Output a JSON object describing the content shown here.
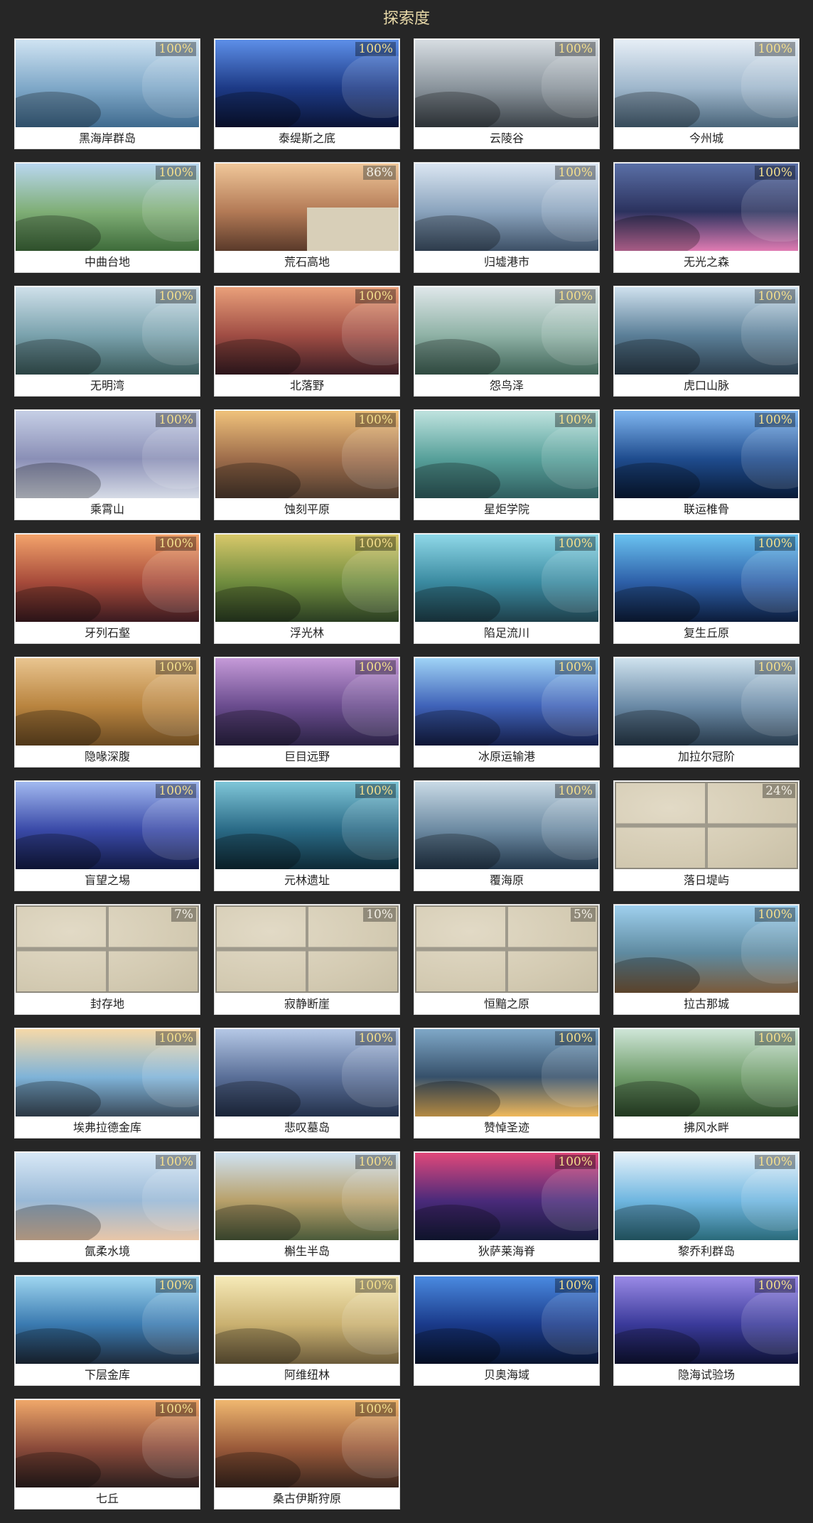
{
  "title": "探索度",
  "colors": {
    "background": "#262626",
    "title": "#e8d9a8",
    "percent": "#f3de8c",
    "card": "#ffffff"
  },
  "regions": [
    {
      "name": "黑海岸群岛",
      "progress": "100%",
      "thumb": "photo",
      "palette": [
        "#cfe3f2",
        "#7fa8c8",
        "#3f6a8e"
      ]
    },
    {
      "name": "泰缇斯之底",
      "progress": "100%",
      "thumb": "photo",
      "palette": [
        "#5d8fe8",
        "#1d3a86",
        "#0a1436"
      ]
    },
    {
      "name": "云陵谷",
      "progress": "100%",
      "thumb": "photo",
      "palette": [
        "#d7dde2",
        "#8a949c",
        "#3b4248"
      ]
    },
    {
      "name": "今州城",
      "progress": "100%",
      "thumb": "photo",
      "palette": [
        "#e6eef6",
        "#9fb7cc",
        "#496479"
      ]
    },
    {
      "name": "中曲台地",
      "progress": "100%",
      "thumb": "photo",
      "palette": [
        "#b9d7f0",
        "#7fae76",
        "#3e6b3a"
      ]
    },
    {
      "name": "荒石高地",
      "progress": "86%",
      "thumb": "mixed",
      "palette": [
        "#f0c79a",
        "#b37a56",
        "#5a3a2a"
      ]
    },
    {
      "name": "归墟港市",
      "progress": "100%",
      "thumb": "photo",
      "palette": [
        "#dbe6f2",
        "#8aa3bd",
        "#3d5066"
      ]
    },
    {
      "name": "无光之森",
      "progress": "100%",
      "thumb": "photo",
      "palette": [
        "#5a6fa6",
        "#2b325e",
        "#e07bb2"
      ]
    },
    {
      "name": "无明湾",
      "progress": "100%",
      "thumb": "photo",
      "palette": [
        "#cfe0ea",
        "#7aa2ad",
        "#3a5a5a"
      ]
    },
    {
      "name": "北落野",
      "progress": "100%",
      "thumb": "photo",
      "palette": [
        "#e9a07a",
        "#a04d44",
        "#3a1d24"
      ]
    },
    {
      "name": "怨鸟泽",
      "progress": "100%",
      "thumb": "photo",
      "palette": [
        "#dfe7ea",
        "#8fb2a6",
        "#3f6356"
      ]
    },
    {
      "name": "虎口山脉",
      "progress": "100%",
      "thumb": "photo",
      "palette": [
        "#cfe1ee",
        "#5b7f98",
        "#2a3b49"
      ]
    },
    {
      "name": "乘霄山",
      "progress": "100%",
      "thumb": "photo",
      "palette": [
        "#c6cfe6",
        "#8a8fb6",
        "#d6dbe6"
      ]
    },
    {
      "name": "蚀刻平原",
      "progress": "100%",
      "thumb": "photo",
      "palette": [
        "#f0c27b",
        "#9e6d4b",
        "#4c3a2e"
      ]
    },
    {
      "name": "星炬学院",
      "progress": "100%",
      "thumb": "photo",
      "palette": [
        "#bfe3df",
        "#57a09a",
        "#2f5d5e"
      ]
    },
    {
      "name": "联运椎骨",
      "progress": "100%",
      "thumb": "photo",
      "palette": [
        "#7fb6f0",
        "#1f4c8e",
        "#081a36"
      ]
    },
    {
      "name": "牙列石壑",
      "progress": "100%",
      "thumb": "photo",
      "palette": [
        "#f3a36b",
        "#a64a3a",
        "#3a1a20"
      ]
    },
    {
      "name": "浮光林",
      "progress": "100%",
      "thumb": "photo",
      "palette": [
        "#d8c86a",
        "#6f8c3e",
        "#2a3d22"
      ]
    },
    {
      "name": "陷足流川",
      "progress": "100%",
      "thumb": "photo",
      "palette": [
        "#8fd8e8",
        "#3a8aa0",
        "#1e3f4a"
      ]
    },
    {
      "name": "复生丘原",
      "progress": "100%",
      "thumb": "photo",
      "palette": [
        "#6ac2f0",
        "#2d5fa8",
        "#0c1c3a"
      ]
    },
    {
      "name": "隐喙深腹",
      "progress": "100%",
      "thumb": "photo",
      "palette": [
        "#e9c590",
        "#b9843f",
        "#6a4a22"
      ]
    },
    {
      "name": "巨目远野",
      "progress": "100%",
      "thumb": "photo",
      "palette": [
        "#c59ad8",
        "#6a4c8e",
        "#2a2244"
      ]
    },
    {
      "name": "冰原运输港",
      "progress": "100%",
      "thumb": "photo",
      "palette": [
        "#9fd3f6",
        "#3f62b8",
        "#141e48"
      ]
    },
    {
      "name": "加拉尔冠阶",
      "progress": "100%",
      "thumb": "photo",
      "palette": [
        "#cfe2ee",
        "#6a8aa6",
        "#27394a"
      ]
    },
    {
      "name": "盲望之埸",
      "progress": "100%",
      "thumb": "photo",
      "palette": [
        "#a2b9f0",
        "#3a4aa8",
        "#121a44"
      ]
    },
    {
      "name": "元林遗址",
      "progress": "100%",
      "thumb": "photo",
      "palette": [
        "#7fc6d8",
        "#2a6a86",
        "#0e2a36"
      ]
    },
    {
      "name": "覆海原",
      "progress": "100%",
      "thumb": "photo",
      "palette": [
        "#c9dae6",
        "#6c8aa2",
        "#22364a"
      ]
    },
    {
      "name": "落日堤屿",
      "progress": "24%",
      "thumb": "map",
      "palette": [
        "#e2dac6",
        "#d4cbb3",
        "#c8bfa6"
      ]
    },
    {
      "name": "封存地",
      "progress": "7%",
      "thumb": "map",
      "palette": [
        "#e2dac6",
        "#d4cbb3",
        "#c8bfa6"
      ]
    },
    {
      "name": "寂静断崖",
      "progress": "10%",
      "thumb": "map",
      "palette": [
        "#e2dac6",
        "#d4cbb3",
        "#c8bfa6"
      ]
    },
    {
      "name": "恒黯之原",
      "progress": "5%",
      "thumb": "map",
      "palette": [
        "#e2dac6",
        "#d4cbb3",
        "#c8bfa6"
      ]
    },
    {
      "name": "拉古那城",
      "progress": "100%",
      "thumb": "photo",
      "palette": [
        "#9fd0ee",
        "#5e8aa0",
        "#7a5a3a"
      ]
    },
    {
      "name": "埃弗拉德金库",
      "progress": "100%",
      "thumb": "photo",
      "palette": [
        "#f6d9a8",
        "#7fb3d8",
        "#3a4a5a"
      ]
    },
    {
      "name": "悲叹墓岛",
      "progress": "100%",
      "thumb": "photo",
      "palette": [
        "#b5c8e6",
        "#5a6f98",
        "#23304a"
      ]
    },
    {
      "name": "赞悼圣迹",
      "progress": "100%",
      "thumb": "photo",
      "palette": [
        "#7fa8c8",
        "#36506a",
        "#f0b85a"
      ]
    },
    {
      "name": "拂风水畔",
      "progress": "100%",
      "thumb": "photo",
      "palette": [
        "#cfe6d8",
        "#6f9c6a",
        "#2d4a2a"
      ]
    },
    {
      "name": "氤柔水境",
      "progress": "100%",
      "thumb": "photo",
      "palette": [
        "#d8e8f6",
        "#98b8d6",
        "#e8c6a8"
      ]
    },
    {
      "name": "槲生半岛",
      "progress": "100%",
      "thumb": "photo",
      "palette": [
        "#cfe2f2",
        "#b8a06a",
        "#4a5a3a"
      ]
    },
    {
      "name": "狄萨莱海脊",
      "progress": "100%",
      "thumb": "photo",
      "palette": [
        "#e0487a",
        "#4a2a7a",
        "#141a3a"
      ]
    },
    {
      "name": "黎乔利群岛",
      "progress": "100%",
      "thumb": "photo",
      "palette": [
        "#e6f2fa",
        "#6fb6e0",
        "#2a6a7a"
      ]
    },
    {
      "name": "下层金库",
      "progress": "100%",
      "thumb": "photo",
      "palette": [
        "#9fd6f0",
        "#3a7ab0",
        "#1e2a3a"
      ]
    },
    {
      "name": "阿维纽林",
      "progress": "100%",
      "thumb": "photo",
      "palette": [
        "#f6eab8",
        "#c9b070",
        "#6a5a3a"
      ]
    },
    {
      "name": "贝奥海域",
      "progress": "100%",
      "thumb": "photo",
      "palette": [
        "#4a8ae0",
        "#1a3a8a",
        "#08142e"
      ]
    },
    {
      "name": "隐海试验场",
      "progress": "100%",
      "thumb": "photo",
      "palette": [
        "#9a8ae6",
        "#3a3a9a",
        "#0e1234"
      ]
    },
    {
      "name": "七丘",
      "progress": "100%",
      "thumb": "photo",
      "palette": [
        "#f0a86a",
        "#8a4a3a",
        "#2a1e1e"
      ]
    },
    {
      "name": "桑古伊斯狩原",
      "progress": "100%",
      "thumb": "photo",
      "palette": [
        "#f0b870",
        "#9a5a3a",
        "#3a261e"
      ]
    }
  ]
}
